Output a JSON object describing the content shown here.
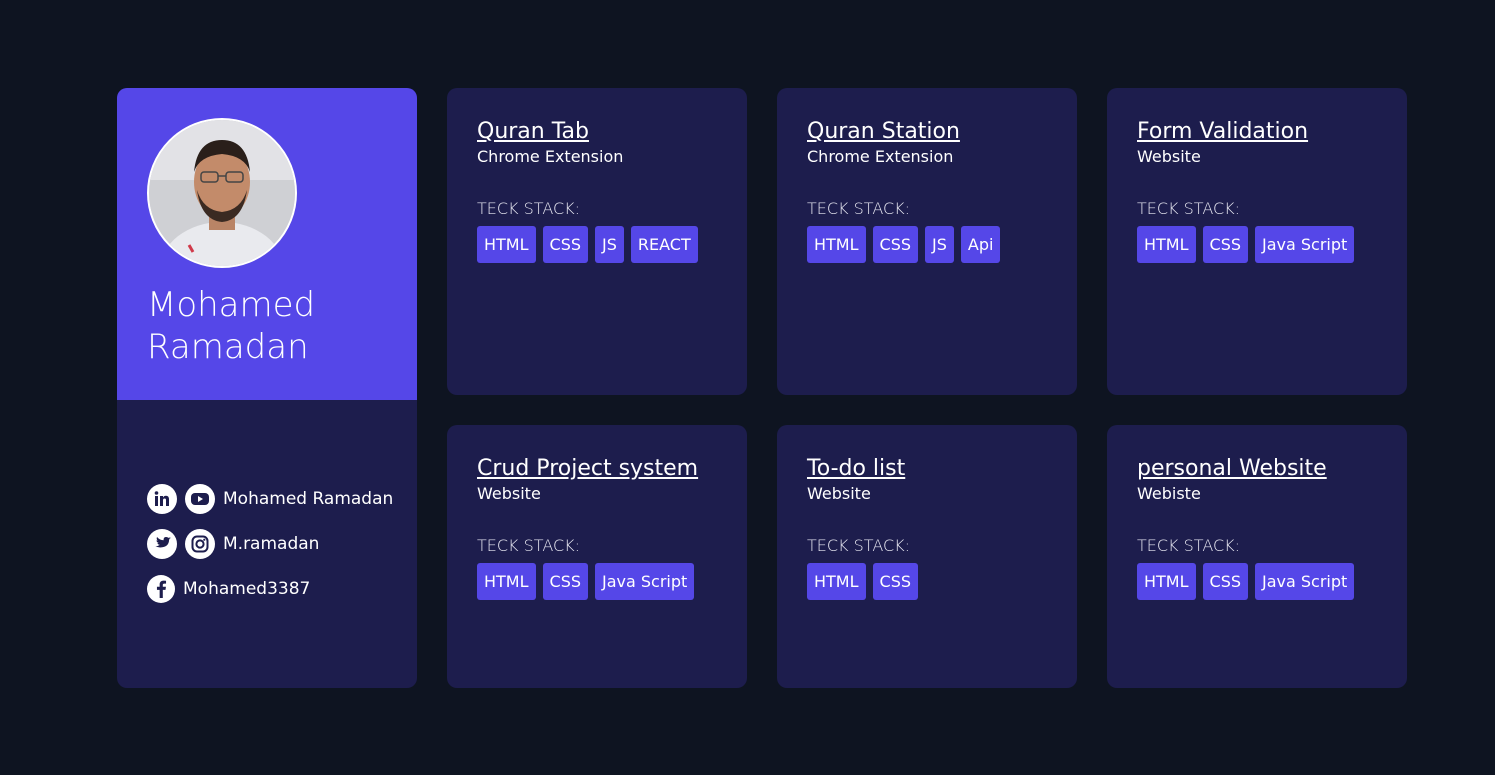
{
  "profile": {
    "name_line1": "Mohamed",
    "name_line2": "Ramadan",
    "social": [
      {
        "icons": [
          "linkedin-icon",
          "youtube-icon"
        ],
        "text": "Mohamed Ramadan"
      },
      {
        "icons": [
          "twitter-icon",
          "instagram-icon"
        ],
        "text": "M.ramadan"
      },
      {
        "icons": [
          "facebook-icon"
        ],
        "text": "Mohamed3387"
      }
    ]
  },
  "stack_label": "TECK STACK:",
  "projects": [
    {
      "title": "Quran Tab",
      "subtitle": "Chrome Extension",
      "tags": [
        "HTML",
        "CSS",
        "JS",
        "REACT"
      ]
    },
    {
      "title": "Quran Station",
      "subtitle": "Chrome Extension",
      "tags": [
        "HTML",
        "CSS",
        "JS",
        "Api"
      ]
    },
    {
      "title": "Form Validation",
      "subtitle": "Website",
      "tags": [
        "HTML",
        "CSS",
        "Java Script"
      ]
    },
    {
      "title": "Crud Project system",
      "subtitle": "Website",
      "tags": [
        "HTML",
        "CSS",
        "Java Script"
      ]
    },
    {
      "title": "To-do list",
      "subtitle": "Website",
      "tags": [
        "HTML",
        "CSS"
      ]
    },
    {
      "title": "personal Website",
      "subtitle": "Webiste",
      "tags": [
        "HTML",
        "CSS",
        "Java Script"
      ]
    }
  ],
  "colors": {
    "background": "#0e1421",
    "card": "#1d1d4d",
    "accent": "#5547e8"
  }
}
